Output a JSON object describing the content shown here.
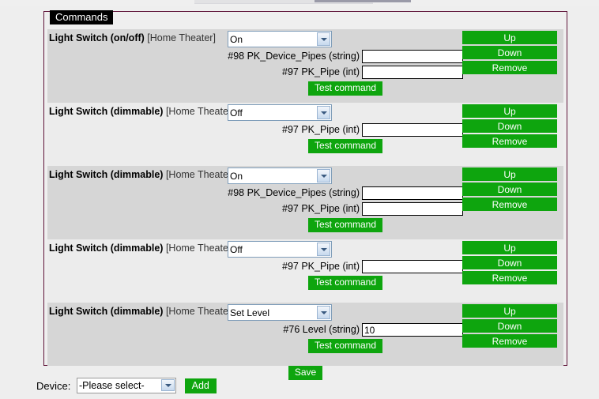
{
  "fieldset": {
    "legend": "Commands"
  },
  "colors": {
    "green_button": "#0ea50e",
    "fieldset_border": "#5e1338",
    "legend_bg": "#000000",
    "row_odd_bg": "#d6d6d6",
    "row_even_bg": "#ececec"
  },
  "row_buttons": {
    "up": "Up",
    "down": "Down",
    "remove": "Remove"
  },
  "test_label": "Test command",
  "save_label": "Save",
  "commands": [
    {
      "device_type": "Light Switch (on/off)",
      "room": "[Home Theater]",
      "command": "On",
      "params": [
        {
          "label": "#98 PK_Device_Pipes (string)",
          "value": ""
        },
        {
          "label": "#97 PK_Pipe (int)",
          "value": ""
        }
      ]
    },
    {
      "device_type": "Light Switch (dimmable)",
      "room": "[Home Theater]",
      "command": "Off",
      "params": [
        {
          "label": "#97 PK_Pipe (int)",
          "value": ""
        }
      ]
    },
    {
      "device_type": "Light Switch (dimmable)",
      "room": "[Home Theater]",
      "command": "On",
      "params": [
        {
          "label": "#98 PK_Device_Pipes (string)",
          "value": ""
        },
        {
          "label": "#97 PK_Pipe (int)",
          "value": ""
        }
      ]
    },
    {
      "device_type": "Light Switch (dimmable)",
      "room": "[Home Theater]",
      "command": "Off",
      "params": [
        {
          "label": "#97 PK_Pipe (int)",
          "value": ""
        }
      ]
    },
    {
      "device_type": "Light Switch (dimmable)",
      "room": "[Home Theater]",
      "command": "Set Level",
      "params": [
        {
          "label": "#76 Level (string)",
          "value": "10"
        }
      ]
    }
  ],
  "device_bar": {
    "label": "Device:",
    "selected": "-Please select-",
    "add_label": "Add"
  }
}
